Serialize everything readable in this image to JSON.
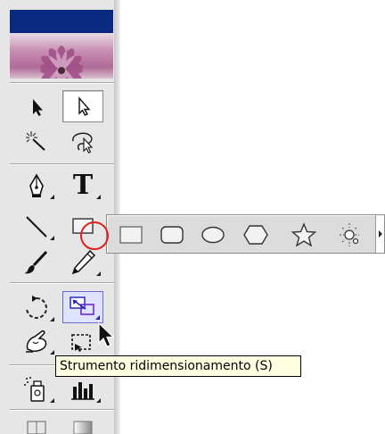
{
  "toolbox": {
    "tools": [
      {
        "name": "selection-tool",
        "icon": "black-arrow-icon"
      },
      {
        "name": "direct-selection-tool",
        "icon": "white-arrow-icon",
        "selected": true
      },
      {
        "name": "magic-wand-tool",
        "icon": "magic-wand-icon"
      },
      {
        "name": "lasso-tool",
        "icon": "lasso-icon"
      },
      {
        "name": "pen-tool",
        "icon": "pen-nib-icon"
      },
      {
        "name": "type-tool",
        "icon": "type-t-icon",
        "glyph": "T"
      },
      {
        "name": "line-segment-tool",
        "icon": "line-segment-icon"
      },
      {
        "name": "rectangle-tool",
        "icon": "rectangle-icon"
      },
      {
        "name": "paintbrush-tool",
        "icon": "paintbrush-icon"
      },
      {
        "name": "pencil-tool",
        "icon": "pencil-icon"
      },
      {
        "name": "rotate-tool",
        "icon": "rotate-icon"
      },
      {
        "name": "scale-tool",
        "icon": "scale-icon",
        "active": true
      },
      {
        "name": "warp-tool",
        "icon": "warp-hand-icon"
      },
      {
        "name": "free-transform-tool",
        "icon": "free-transform-icon"
      },
      {
        "name": "symbol-sprayer-tool",
        "icon": "symbol-sprayer-icon"
      },
      {
        "name": "graph-tool",
        "icon": "column-graph-icon"
      }
    ]
  },
  "flyout": {
    "tools": [
      {
        "name": "rectangle",
        "icon": "rectangle-icon"
      },
      {
        "name": "rounded-rectangle",
        "icon": "rounded-rectangle-icon"
      },
      {
        "name": "ellipse",
        "icon": "ellipse-icon"
      },
      {
        "name": "polygon",
        "icon": "polygon-icon"
      },
      {
        "name": "star",
        "icon": "star-icon"
      },
      {
        "name": "flare",
        "icon": "flare-icon"
      }
    ]
  },
  "tooltip": {
    "text": "Strumento ridimensionamento (S)"
  },
  "colors": {
    "titlebar": "#0a2a82",
    "tooltip_bg": "#ffffe1",
    "highlight": "#e02020",
    "scale_active": "#6a6ad0"
  }
}
